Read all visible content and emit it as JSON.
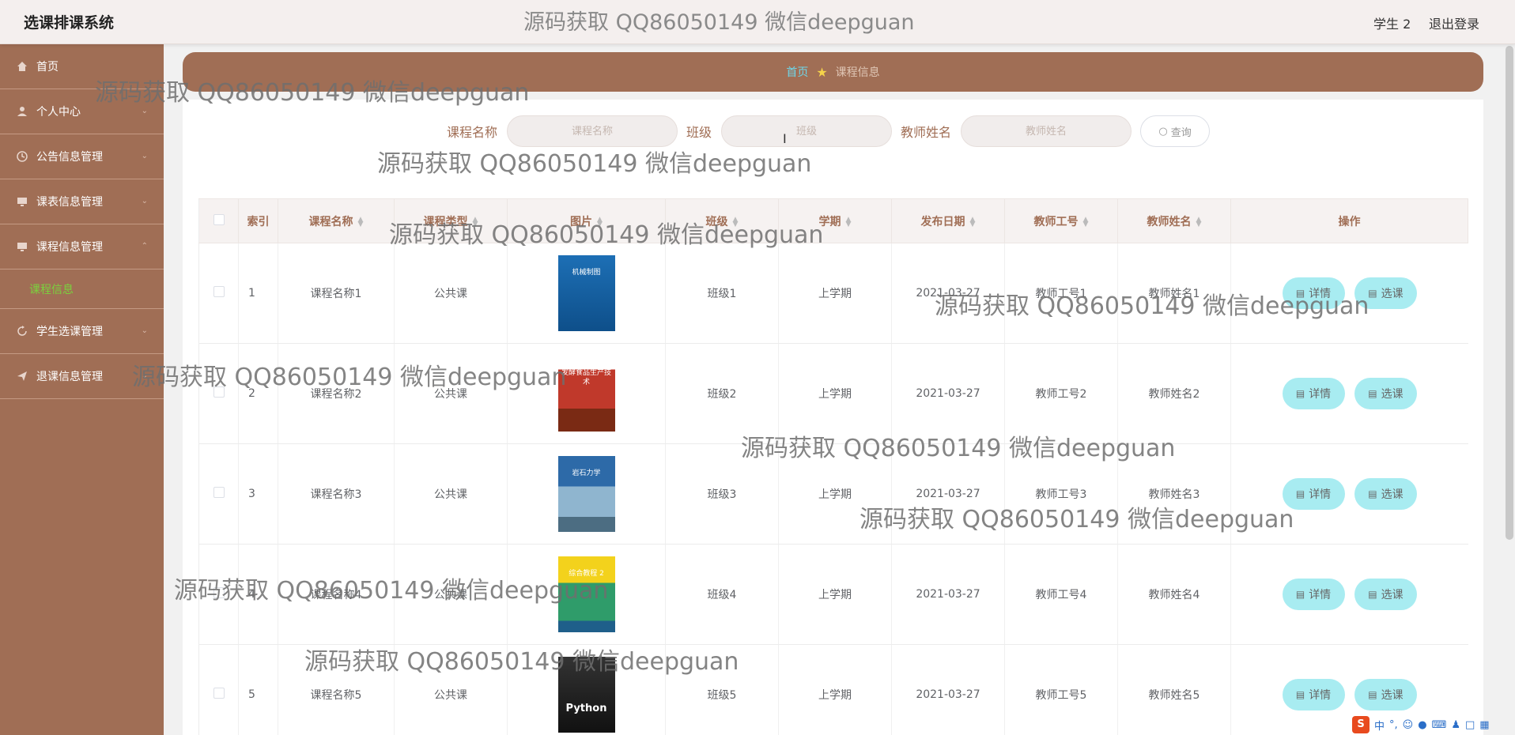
{
  "app_title": "选课排课系统",
  "header": {
    "center_text": "源码获取 QQ86050149 微信deepguan",
    "user": "学生 2",
    "logout": "退出登录"
  },
  "sidebar": {
    "items": [
      {
        "label": "首页",
        "icon": "home-icon"
      },
      {
        "label": "个人中心",
        "icon": "user-icon"
      },
      {
        "label": "公告信息管理",
        "icon": "clock-icon"
      },
      {
        "label": "课表信息管理",
        "icon": "monitor-icon"
      },
      {
        "label": "课程信息管理",
        "icon": "monitor-icon"
      },
      {
        "label": "学生选课管理",
        "icon": "refresh-icon"
      },
      {
        "label": "退课信息管理",
        "icon": "send-icon"
      }
    ],
    "sub_item": "课程信息"
  },
  "breadcrumb": {
    "home": "首页",
    "current": "课程信息"
  },
  "search": {
    "course_label": "课程名称",
    "course_placeholder": "课程名称",
    "class_label": "班级",
    "class_placeholder": "班级",
    "teacher_label": "教师姓名",
    "teacher_placeholder": "教师姓名",
    "button": "查询"
  },
  "table": {
    "headers": [
      "索引",
      "课程名称",
      "课程类型",
      "图片",
      "班级",
      "学期",
      "发布日期",
      "教师工号",
      "教师姓名",
      "操作"
    ],
    "rows": [
      {
        "idx": "1",
        "name": "课程名称1",
        "type": "公共课",
        "cover": "机械制图",
        "cls": "班级1",
        "term": "上学期",
        "date": "2021-03-27",
        "tid": "教师工号1",
        "tname": "教师姓名1"
      },
      {
        "idx": "2",
        "name": "课程名称2",
        "type": "公共课",
        "cover": "发酵食品生产技术",
        "cls": "班级2",
        "term": "上学期",
        "date": "2021-03-27",
        "tid": "教师工号2",
        "tname": "教师姓名2"
      },
      {
        "idx": "3",
        "name": "课程名称3",
        "type": "公共课",
        "cover": "岩石力学",
        "cls": "班级3",
        "term": "上学期",
        "date": "2021-03-27",
        "tid": "教师工号3",
        "tname": "教师姓名3"
      },
      {
        "idx": "4",
        "name": "课程名称4",
        "type": "公共课",
        "cover": "综合教程 2",
        "cls": "班级4",
        "term": "上学期",
        "date": "2021-03-27",
        "tid": "教师工号4",
        "tname": "教师姓名4"
      },
      {
        "idx": "5",
        "name": "课程名称5",
        "type": "公共课",
        "cover": "Python",
        "cls": "班级5",
        "term": "上学期",
        "date": "2021-03-27",
        "tid": "教师工号5",
        "tname": "教师姓名5"
      }
    ],
    "detail_btn": "详情",
    "select_btn": "选课"
  },
  "watermark": "源码获取 QQ86050149 微信deepguan",
  "colors": {
    "sidebar": "#a06e55",
    "accent_green": "#7ad23d",
    "action_button": "#a8ecf1",
    "breadcrumb_home": "#6fd6e8"
  }
}
